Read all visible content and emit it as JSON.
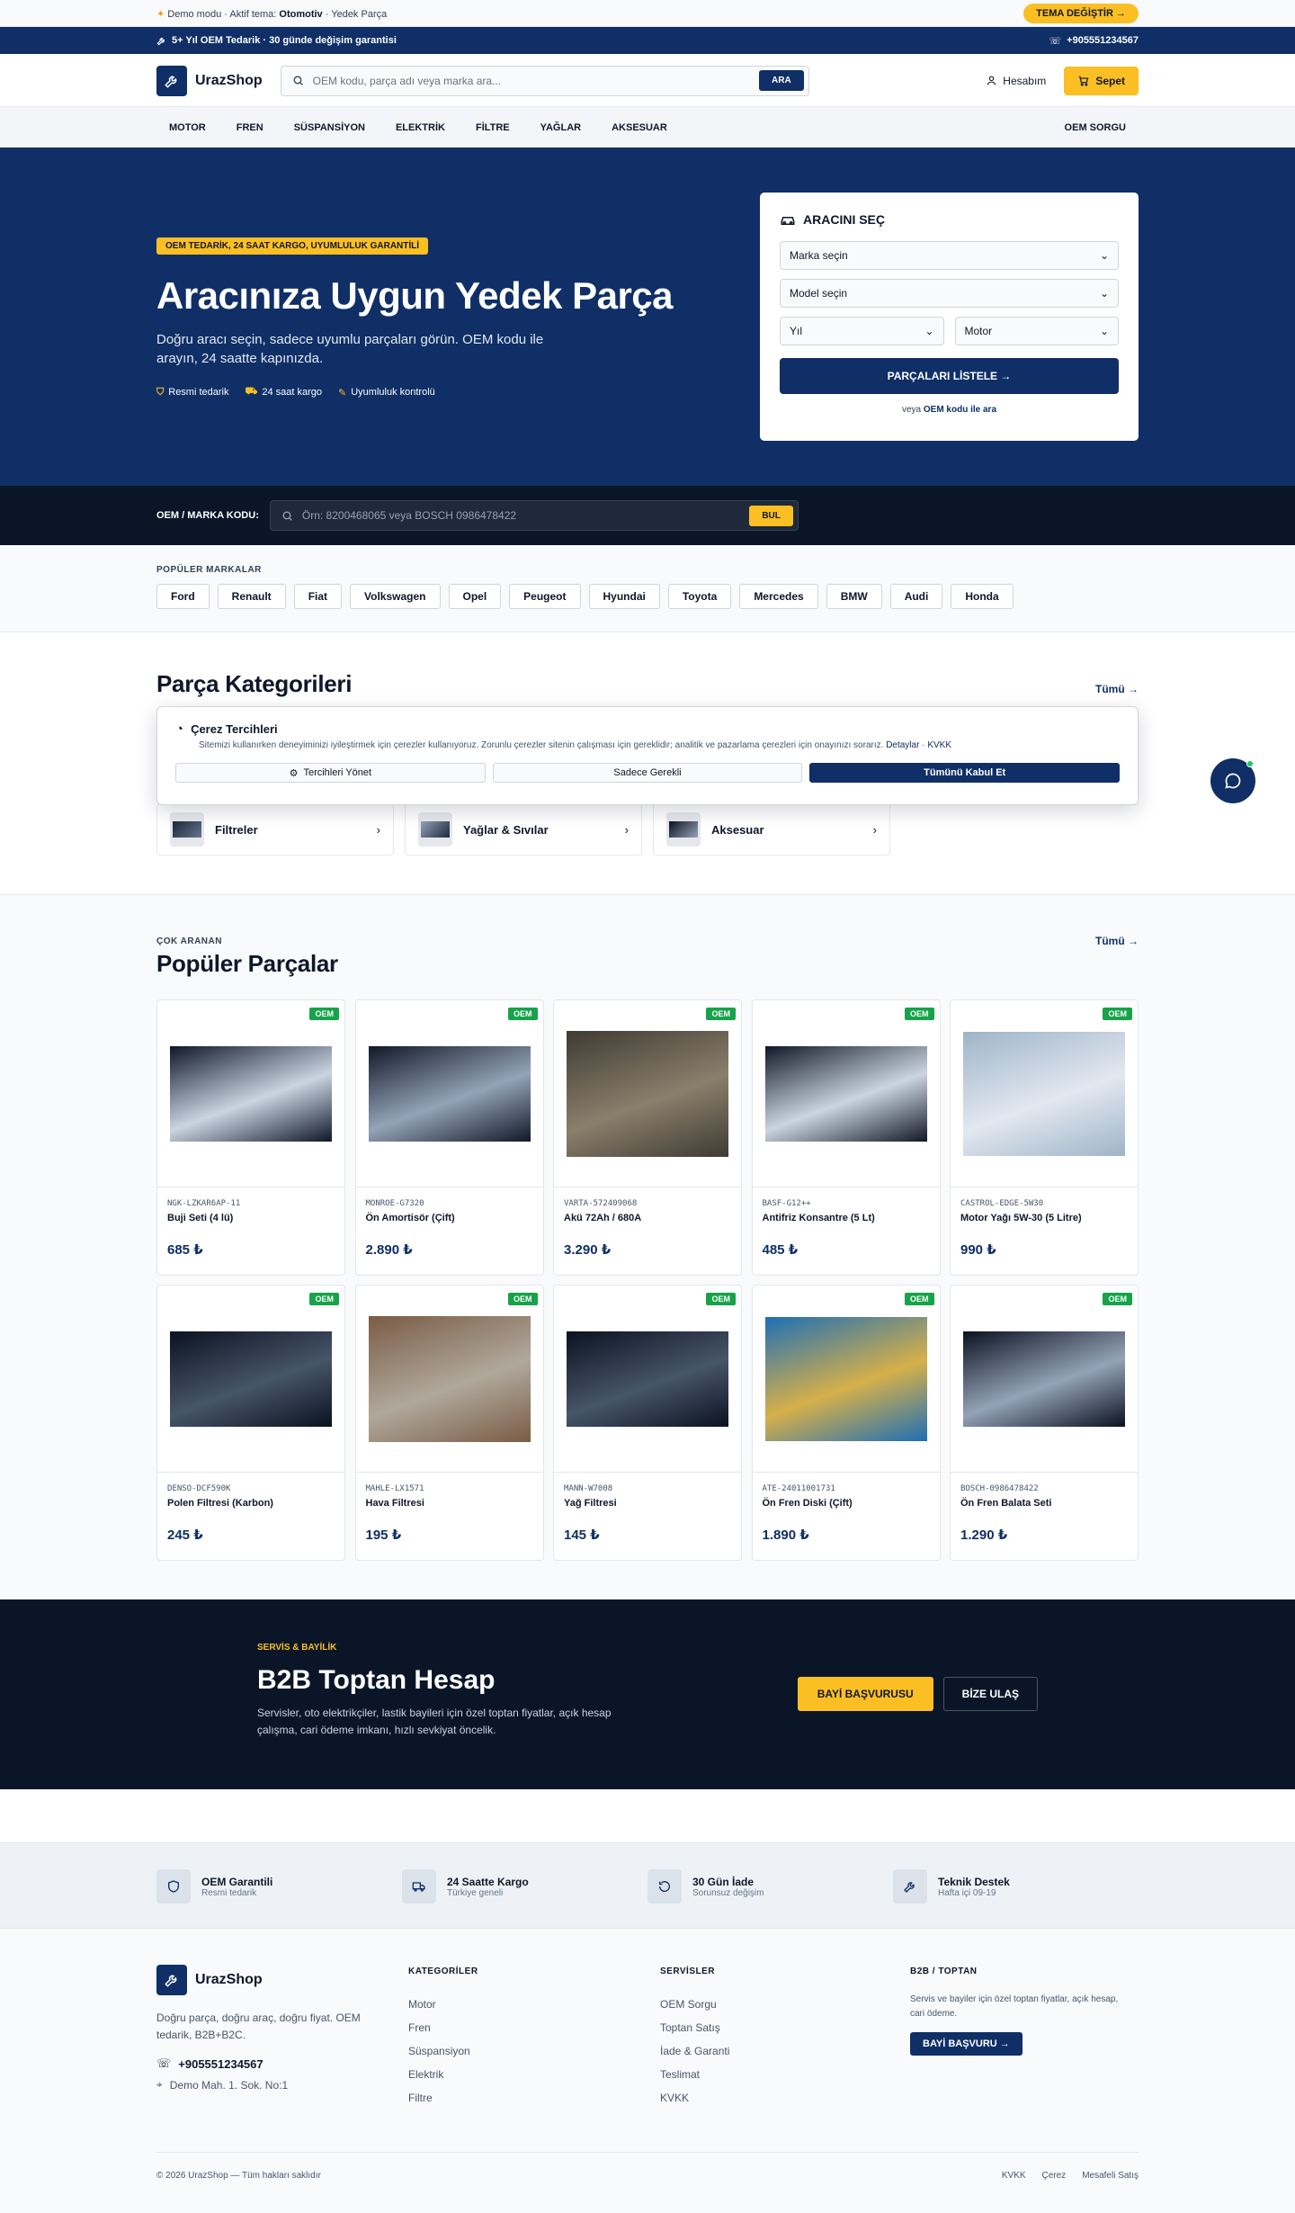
{
  "demo": {
    "prefix": "Demo modu · Aktif tema:",
    "theme": "Otomotiv",
    "suffix": "· Yedek Parça",
    "theme_button": "TEMA DEĞİŞTİR →"
  },
  "topbar": {
    "left": "5+ Yıl OEM Tedarik · 30 günde değişim garantisi",
    "phone": "+905551234567"
  },
  "header": {
    "brand": "UrazShop",
    "search_placeholder": "OEM kodu, parça adı veya marka ara...",
    "search_button": "ARA",
    "account": "Hesabım",
    "cart": "Sepet"
  },
  "nav": {
    "items": [
      "MOTOR",
      "FREN",
      "SÜSPANSİYON",
      "ELEKTRİK",
      "FİLTRE",
      "YAĞLAR",
      "AKSESUAR"
    ],
    "right": "OEM SORGU"
  },
  "hero": {
    "badge": "OEM TEDARİK, 24 SAAT KARGO, UYUMLULUK GARANTİLİ",
    "title": "Aracınıza Uygun Yedek Parça",
    "subtitle": "Doğru aracı seçin, sadece uyumlu parçaları görün. OEM kodu ile arayın, 24 saatte kapınızda.",
    "features": [
      "Resmi tedarik",
      "24 saat kargo",
      "Uyumluluk kontrolü"
    ]
  },
  "vehicle": {
    "title": "ARACINI SEÇ",
    "brand": "Marka seçin",
    "model": "Model seçin",
    "year": "Yıl",
    "engine": "Motor",
    "button": "PARÇALARI LİSTELE →",
    "foot_prefix": "veya",
    "foot_link": "OEM kodu ile ara"
  },
  "oem": {
    "label": "OEM / MARKA KODU:",
    "placeholder": "Örn: 8200468065 veya BOSCH 0986478422",
    "button": "BUL"
  },
  "brands": {
    "title": "POPÜLER MARKALAR",
    "items": [
      "Ford",
      "Renault",
      "Fiat",
      "Volkswagen",
      "Opel",
      "Peugeot",
      "Hyundai",
      "Toyota",
      "Mercedes",
      "BMW",
      "Audi",
      "Honda"
    ]
  },
  "categories": {
    "title": "Parça Kategorileri",
    "see_all": "Tümü →",
    "items": [
      {
        "name": "Filtreler"
      },
      {
        "name": "Yağlar & Sıvılar"
      },
      {
        "name": "Aksesuar"
      }
    ]
  },
  "cookie": {
    "title": "Çerez Tercihleri",
    "text": "Sitemizi kullanırken deneyiminizi iyileştirmek için çerezler kullanıyoruz. Zorunlu çerezler sitenin çalışması için gereklidir; analitik ve pazarlama çerezleri için onayınızı sorarız.",
    "link_details": "Detaylar",
    "link_kvkk": "KVKK",
    "btn_manage": "Tercihleri Yönet",
    "btn_necessary": "Sadece Gerekli",
    "btn_accept": "Tümünü Kabul Et"
  },
  "products": {
    "eyebrow": "ÇOK ARANAN",
    "title": "Popüler Parçalar",
    "see_all": "Tümü →",
    "badge": "OEM",
    "items": [
      {
        "code": "NGK-LZKAR6AP-11",
        "name": "Buji Seti (4 lü)",
        "price": "685 ₺",
        "img": [
          "#0f172a",
          "#cbd5e1"
        ]
      },
      {
        "code": "MONROE-G7320",
        "name": "Ön Amortisör (Çift)",
        "price": "2.890 ₺",
        "img": [
          "#111827",
          "#94a3b8"
        ]
      },
      {
        "code": "VARTA-572409068",
        "name": "Akü 72Ah / 680A",
        "price": "3.290 ₺",
        "img": [
          "#3f3a33",
          "#8a7f6b"
        ]
      },
      {
        "code": "BASF-G12++",
        "name": "Antifriz Konsantre (5 Lt)",
        "price": "485 ₺",
        "img": [
          "#111827",
          "#cbd5e1"
        ]
      },
      {
        "code": "CASTROL-EDGE-5W30",
        "name": "Motor Yağı 5W-30 (5 Litre)",
        "price": "990 ₺",
        "img": [
          "#9fb4c8",
          "#e2e8f0"
        ]
      },
      {
        "code": "DENSO-DCF590K",
        "name": "Polen Filtresi (Karbon)",
        "price": "245 ₺",
        "img": [
          "#0b1220",
          "#475569"
        ]
      },
      {
        "code": "MAHLE-LX1571",
        "name": "Hava Filtresi",
        "price": "195 ₺",
        "img": [
          "#7a5c45",
          "#b0a89c"
        ]
      },
      {
        "code": "MANN-W7008",
        "name": "Yağ Filtresi",
        "price": "145 ₺",
        "img": [
          "#0b1220",
          "#475569"
        ]
      },
      {
        "code": "ATE-24011001731",
        "name": "Ön Fren Diski (Çift)",
        "price": "1.890 ₺",
        "img": [
          "#1e6fb5",
          "#d6b04a"
        ]
      },
      {
        "code": "BOSCH-0986478422",
        "name": "Ön Fren Balata Seti",
        "price": "1.290 ₺",
        "img": [
          "#0b1220",
          "#94a3b8"
        ]
      }
    ]
  },
  "b2b": {
    "tag": "SERVİS & BAYİLİK",
    "title": "B2B Toptan Hesap",
    "subtitle": "Servisler, oto elektrikçiler, lastik bayileri için özel toptan fiyatlar, açık hesap çalışma, cari ödeme imkanı, hızlı sevkiyat öncelik.",
    "btn_primary": "BAYİ BAŞVURUSU",
    "btn_secondary": "BİZE ULAŞ"
  },
  "features": [
    {
      "title": "OEM Garantili",
      "sub": "Resmi tedarik"
    },
    {
      "title": "24 Saatte Kargo",
      "sub": "Türkiye geneli"
    },
    {
      "title": "30 Gün İade",
      "sub": "Sorunsuz değişim"
    },
    {
      "title": "Teknik Destek",
      "sub": "Hafta içi 09-19"
    }
  ],
  "footer": {
    "brand": "UrazShop",
    "desc": "Doğru parça, doğru araç, doğru fiyat. OEM tedarik, B2B+B2C.",
    "phone": "+905551234567",
    "address": "Demo Mah. 1. Sok. No:1",
    "cat_title": "KATEGORİLER",
    "cats": [
      "Motor",
      "Fren",
      "Süspansiyon",
      "Elektrik",
      "Filtre"
    ],
    "srv_title": "SERVİSLER",
    "services": [
      "OEM Sorgu",
      "Toptan Satış",
      "İade & Garanti",
      "Teslimat",
      "KVKK"
    ],
    "b2b_title": "B2B / TOPTAN",
    "b2b_text": "Servis ve bayiler için özel toptan fiyatlar, açık hesap, cari ödeme.",
    "b2b_button": "BAYİ BAŞVURU →",
    "copyright": "© 2026 UrazShop — Tüm hakları saklıdır",
    "links": [
      "KVKK",
      "Çerez",
      "Mesafeli Satış"
    ]
  },
  "colors": {
    "primary": "#0f2f66",
    "accent": "#fbbf24",
    "dark": "#0a1628",
    "oem_green": "#16a34a"
  }
}
